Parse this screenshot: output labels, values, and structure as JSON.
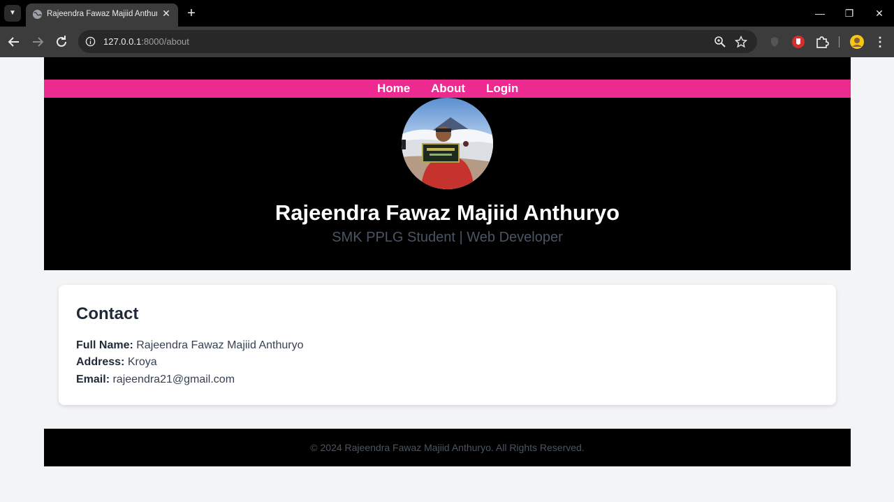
{
  "browser": {
    "tab_title": "Rajeendra Fawaz Majiid Anthuryo",
    "url_host": "127.0.0.1",
    "url_path": ":8000/about"
  },
  "nav": {
    "home": "Home",
    "about": "About",
    "login": "Login"
  },
  "profile": {
    "name": "Rajeendra Fawaz Majiid Anthuryo",
    "tagline": "SMK PPLG Student | Web Developer"
  },
  "contact": {
    "title": "Contact",
    "full_name_label": "Full Name:",
    "full_name": "Rajeendra Fawaz Majiid Anthuryo",
    "address_label": "Address:",
    "address": "Kroya",
    "email_label": "Email:",
    "email": "rajeendra21@gmail.com"
  },
  "footer": {
    "text": "© 2024 Rajeendra Fawaz Majiid Anthuryo. All Rights Reserved."
  },
  "colors": {
    "nav_bar": "#ec2a90",
    "header_bg": "#000000",
    "page_bg": "#f3f4f6"
  }
}
